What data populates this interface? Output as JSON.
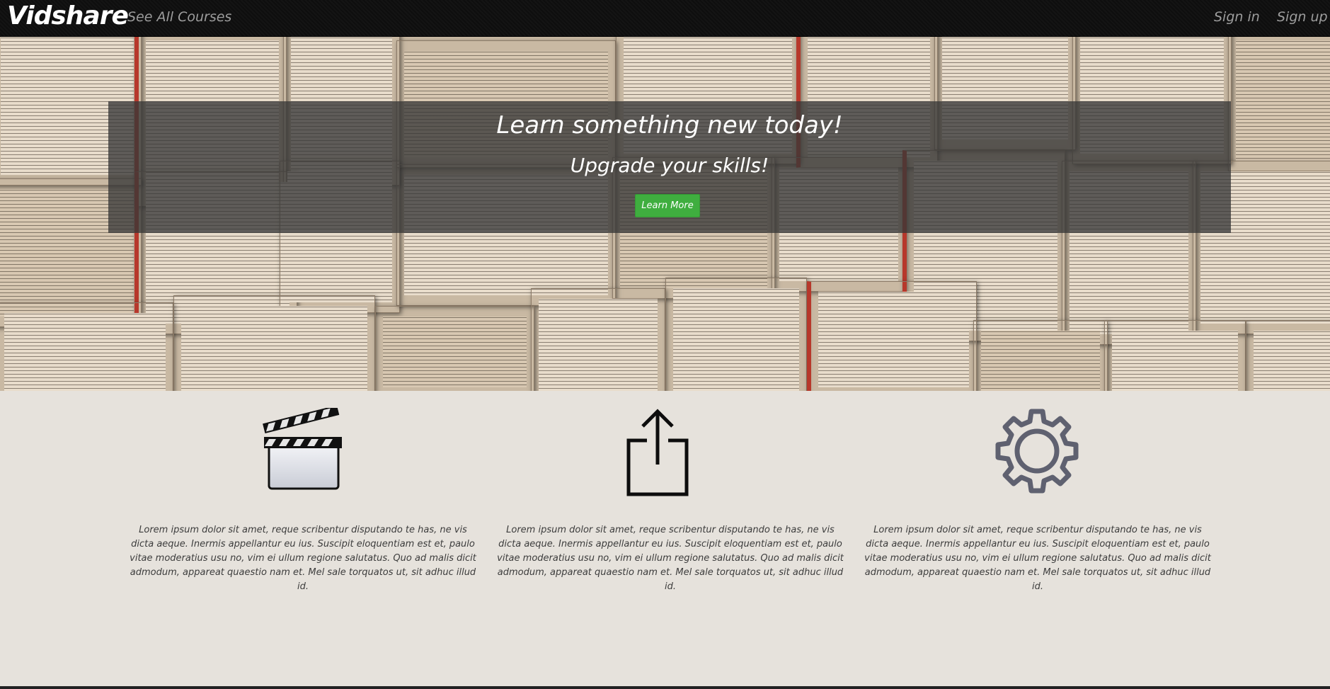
{
  "navbar": {
    "brand": "Vidshare",
    "see_all_courses": "See All Courses",
    "sign_in": "Sign in",
    "sign_up": "Sign up"
  },
  "hero": {
    "title": "Learn something new today!",
    "subtitle": "Upgrade your skills!",
    "button_label": "Learn More"
  },
  "features": [
    {
      "icon": "clapperboard-icon",
      "text": "Lorem ipsum dolor sit amet, reque scribentur disputando te has, ne vis dicta aeque. Inermis appellantur eu ius. Suscipit eloquentiam est et, paulo vitae moderatius usu no, vim ei ullum regione salutatus. Quo ad malis dicit admodum, appareat quaestio nam et. Mel sale torquatos ut, sit adhuc illud id."
    },
    {
      "icon": "share-upload-icon",
      "text": "Lorem ipsum dolor sit amet, reque scribentur disputando te has, ne vis dicta aeque. Inermis appellantur eu ius. Suscipit eloquentiam est et, paulo vitae moderatius usu no, vim ei ullum regione salutatus. Quo ad malis dicit admodum, appareat quaestio nam et. Mel sale torquatos ut, sit adhuc illud id."
    },
    {
      "icon": "gear-icon",
      "text": "Lorem ipsum dolor sit amet, reque scribentur disputando te has, ne vis dicta aeque. Inermis appellantur eu ius. Suscipit eloquentiam est et, paulo vitae moderatius usu no, vim ei ullum regione salutatus. Quo ad malis dicit admodum, appareat quaestio nam et. Mel sale torquatos ut, sit adhuc illud id."
    }
  ],
  "colors": {
    "navbar_bg": "#0e0e0e",
    "nav_link": "#9d9d9d",
    "button_green": "#3fae3f",
    "page_bg": "#e6e2dc",
    "gear_gray": "#5f6170"
  }
}
